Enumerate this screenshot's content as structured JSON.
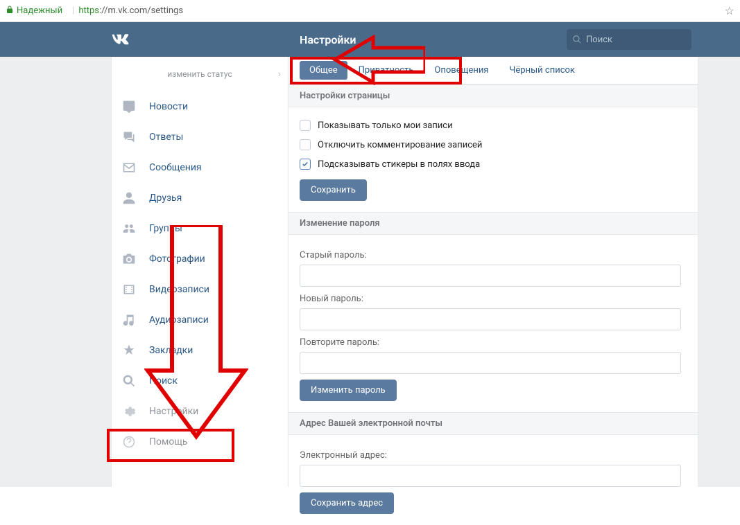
{
  "browser": {
    "secure_label": "Надежный",
    "url_prefix": "https",
    "url_rest": "://m.vk.com/settings"
  },
  "header": {
    "title": "Настройки",
    "search_placeholder": "Поиск"
  },
  "sidebar": {
    "status_label": "изменить статус",
    "items": [
      {
        "label": "Новости"
      },
      {
        "label": "Ответы"
      },
      {
        "label": "Сообщения"
      },
      {
        "label": "Друзья"
      },
      {
        "label": "Группы"
      },
      {
        "label": "Фотографии"
      },
      {
        "label": "Видеозаписи"
      },
      {
        "label": "Аудиозаписи"
      },
      {
        "label": "Закладки"
      },
      {
        "label": "Поиск"
      },
      {
        "label": "Настройки"
      },
      {
        "label": "Помощь"
      }
    ]
  },
  "tabs": [
    {
      "label": "Общее",
      "active": true
    },
    {
      "label": "Приватность",
      "active": false
    },
    {
      "label": "Оповещения",
      "active": false
    },
    {
      "label": "Чёрный список",
      "active": false
    }
  ],
  "section_page": {
    "title": "Настройки страницы",
    "chk1": "Показывать только мои записи",
    "chk2": "Отключить комментирование записей",
    "chk3": "Подсказывать стикеры в полях ввода",
    "save_btn": "Сохранить"
  },
  "section_password": {
    "title": "Изменение пароля",
    "old_label": "Старый пароль:",
    "new_label": "Новый пароль:",
    "repeat_label": "Повторите пароль:",
    "change_btn": "Изменить пароль"
  },
  "section_email": {
    "title": "Адрес Вашей электронной почты",
    "email_label": "Электронный адрес:",
    "save_btn": "Сохранить адрес"
  }
}
